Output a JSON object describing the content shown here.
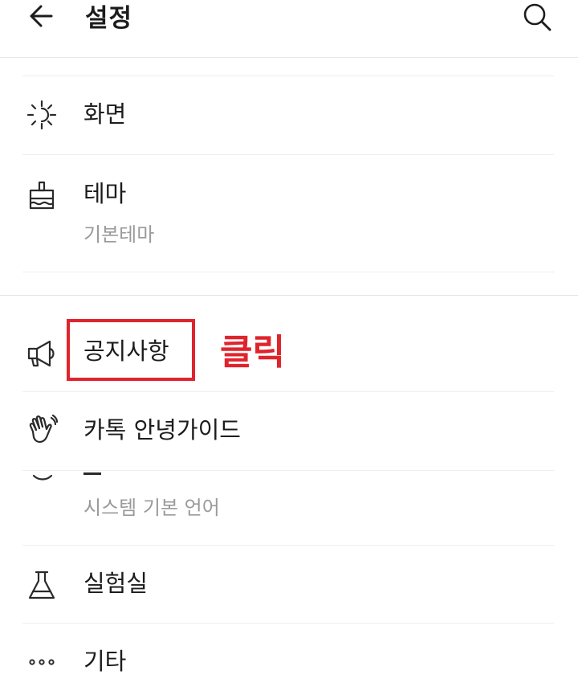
{
  "header": {
    "title": "설정",
    "back_icon": "arrow-left-icon",
    "search_icon": "search-icon"
  },
  "items": [
    {
      "label": "화면",
      "icon": "brightness-icon"
    },
    {
      "label": "테마",
      "sublabel": "기본테마",
      "icon": "paint-brush-icon"
    },
    {
      "label": "공지사항",
      "icon": "megaphone-icon"
    },
    {
      "label": "카톡 안녕가이드",
      "icon": "waving-hand-icon"
    },
    {
      "sublabel": "시스템 기본 언어",
      "icon": "globe-icon"
    },
    {
      "label": "실험실",
      "icon": "flask-icon"
    },
    {
      "label": "기타",
      "icon": "more-dots-icon"
    }
  ],
  "annotation": {
    "text": "클릭",
    "color": "#e0242d"
  }
}
